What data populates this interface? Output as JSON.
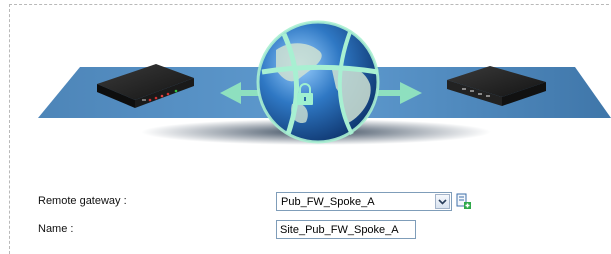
{
  "form": {
    "remote_gateway_label": "Remote gateway :",
    "remote_gateway_value": "Pub_FW_Spoke_A",
    "name_label": "Name :",
    "name_value": "Site_Pub_FW_Spoke_A"
  },
  "icons": {
    "dropdown": "chevron-down-icon",
    "add_gateway": "add-object-icon",
    "tunnel": "lock-icon"
  },
  "colors": {
    "accent": "#5d9bd0",
    "arrow": "#8ee0bf",
    "border": "#7f9db9"
  }
}
